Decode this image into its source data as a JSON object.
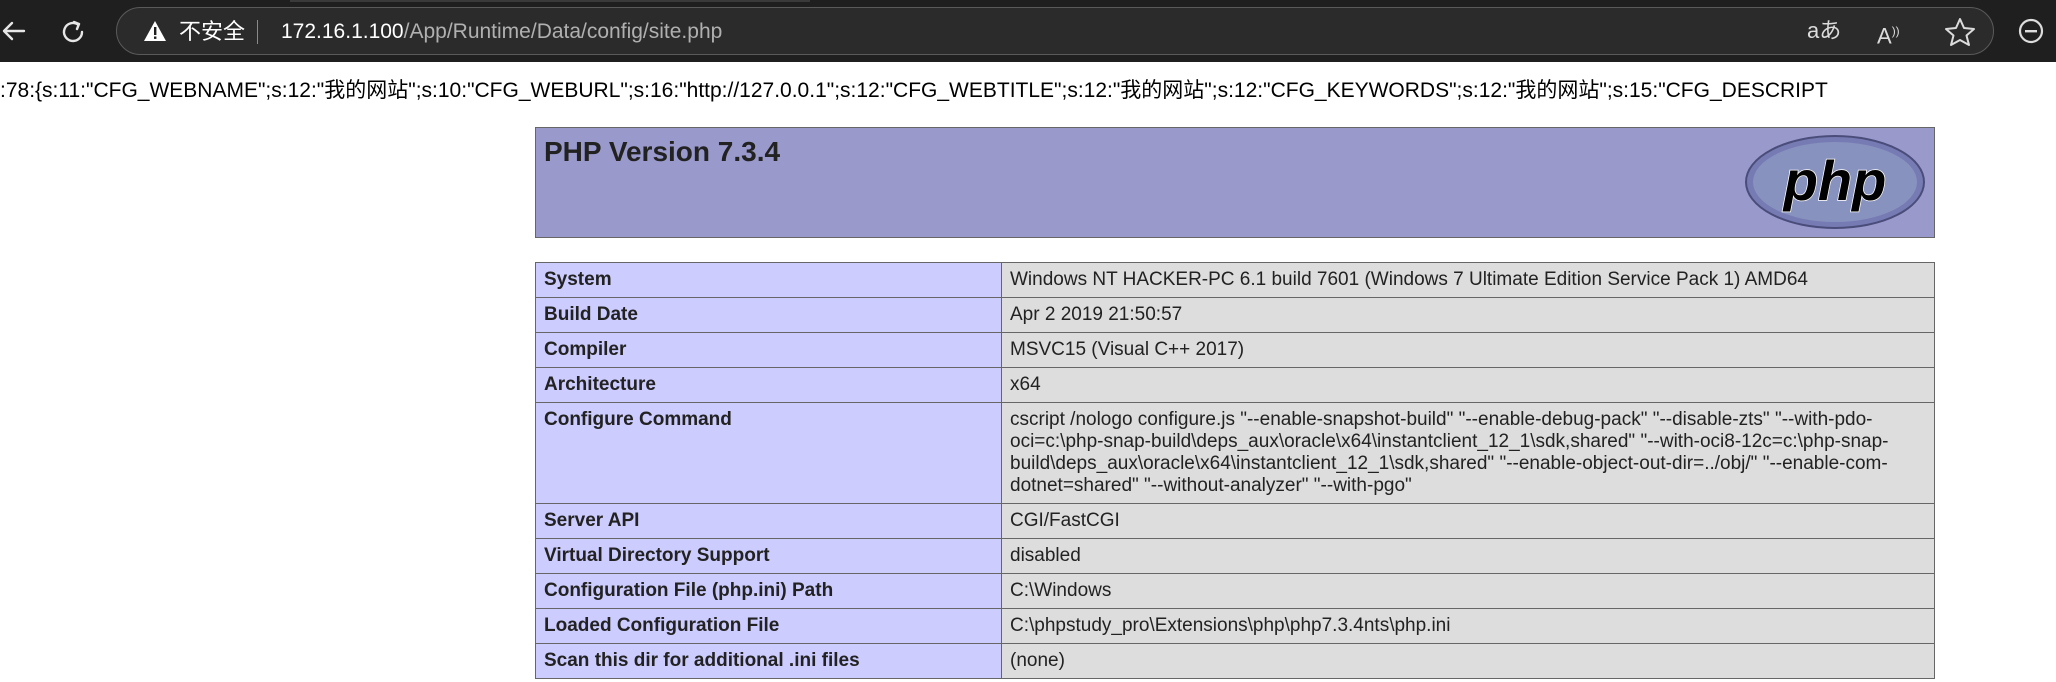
{
  "browser": {
    "security_label": "不安全",
    "url_host": "172.16.1.100",
    "url_path": "/App/Runtime/Data/config/site.php",
    "read_aloud_glyph": "Aͅ",
    "translate_glyph": "aあ"
  },
  "page": {
    "serialized_text": ":78:{s:11:\"CFG_WEBNAME\";s:12:\"我的网站\";s:10:\"CFG_WEBURL\";s:16:\"http://127.0.0.1\";s:12:\"CFG_WEBTITLE\";s:12:\"我的网站\";s:12:\"CFG_KEYWORDS\";s:12:\"我的网站\";s:15:\"CFG_DESCRIPT"
  },
  "phpinfo": {
    "title": "PHP Version 7.3.4",
    "rows": [
      {
        "key": "System",
        "value": "Windows NT HACKER-PC 6.1 build 7601 (Windows 7 Ultimate Edition Service Pack 1) AMD64"
      },
      {
        "key": "Build Date",
        "value": "Apr 2 2019 21:50:57"
      },
      {
        "key": "Compiler",
        "value": "MSVC15 (Visual C++ 2017)"
      },
      {
        "key": "Architecture",
        "value": "x64"
      },
      {
        "key": "Configure Command",
        "value": "cscript /nologo configure.js \"--enable-snapshot-build\" \"--enable-debug-pack\" \"--disable-zts\" \"--with-pdo-oci=c:\\php-snap-build\\deps_aux\\oracle\\x64\\instantclient_12_1\\sdk,shared\" \"--with-oci8-12c=c:\\php-snap-build\\deps_aux\\oracle\\x64\\instantclient_12_1\\sdk,shared\" \"--enable-object-out-dir=../obj/\" \"--enable-com-dotnet=shared\" \"--without-analyzer\" \"--with-pgo\""
      },
      {
        "key": "Server API",
        "value": "CGI/FastCGI"
      },
      {
        "key": "Virtual Directory Support",
        "value": "disabled"
      },
      {
        "key": "Configuration File (php.ini) Path",
        "value": "C:\\Windows"
      },
      {
        "key": "Loaded Configuration File",
        "value": "C:\\phpstudy_pro\\Extensions\\php\\php7.3.4nts\\php.ini"
      },
      {
        "key": "Scan this dir for additional .ini files",
        "value": "(none)"
      }
    ]
  }
}
